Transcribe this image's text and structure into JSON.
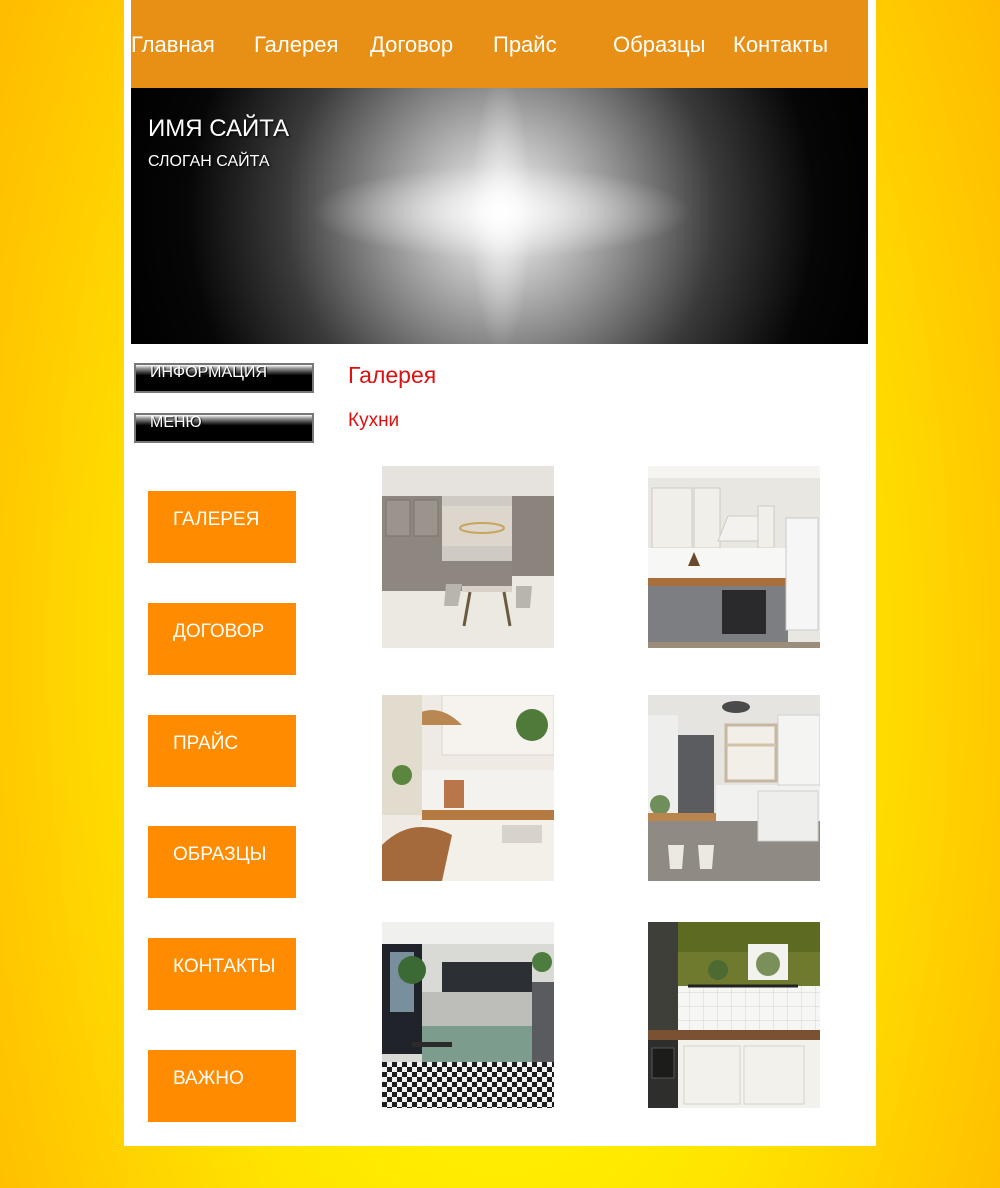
{
  "topnav": {
    "items": [
      "Главная",
      "Галерея",
      "Договор",
      "Прайс",
      "Образцы",
      "Контакты"
    ]
  },
  "banner": {
    "site_name": "ИМЯ САЙТА",
    "slogan": "СЛОГАН САЙТА"
  },
  "sidebar": {
    "info_header": "ИНФОРМАЦИЯ",
    "menu_header": "МЕНЮ",
    "buttons": [
      "ГАЛЕРЕЯ",
      "ДОГОВОР",
      "ПРАЙС",
      "ОБРАЗЦЫ",
      "КОНТАКТЫ",
      "ВАЖНО"
    ]
  },
  "content": {
    "title": "Галерея",
    "subtitle": "Кухни"
  },
  "colors": {
    "nav_bg": "#e89015",
    "button_bg": "#ff8c00",
    "heading": "#dd1111"
  }
}
